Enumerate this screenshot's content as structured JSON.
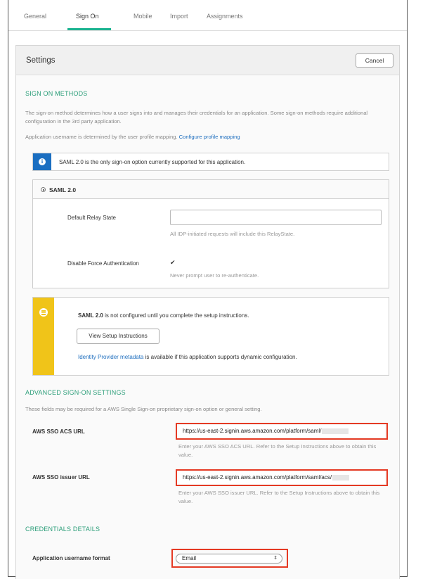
{
  "tabs": [
    "General",
    "Sign On",
    "Mobile",
    "Import",
    "Assignments"
  ],
  "settings": {
    "title": "Settings",
    "cancel_label": "Cancel"
  },
  "sign_on_methods": {
    "title": "SIGN ON METHODS",
    "desc1": "The sign-on method determines how a user signs into and manages their credentials for an application. Some sign-on methods require additional configuration in the 3rd party application.",
    "desc2": "Application username is determined by the user profile mapping.",
    "desc2_link": "Configure profile mapping",
    "info_text": "SAML 2.0 is the only sign-on option currently supported for this application.",
    "saml_label": "SAML 2.0",
    "relay_label": "Default Relay State",
    "relay_value": "",
    "relay_hint": "All IDP-initiated requests will include this RelayState.",
    "force_auth_label": "Disable Force Authentication",
    "force_auth_checked": true,
    "force_auth_hint": "Never prompt user to re-authenticate."
  },
  "warning": {
    "bold": "SAML 2.0",
    "text": " is not configured until you complete the setup instructions.",
    "button_label": "View Setup Instructions",
    "meta_link": "Identity Provider metadata",
    "meta_text": " is available if this application supports dynamic configuration."
  },
  "advanced": {
    "title": "ADVANCED SIGN-ON SETTINGS",
    "desc": "These fields may be required for a AWS Single Sign-on proprietary sign-on option or general setting.",
    "acs_label": "AWS SSO ACS URL",
    "acs_value": "https://us-east-2.signin.aws.amazon.com/platform/saml/",
    "acs_hint": "Enter your AWS SSO ACS URL. Refer to the Setup Instructions above to obtain this value.",
    "issuer_label": "AWS SSO issuer URL",
    "issuer_value": "https://us-east-2.signin.aws.amazon.com/platform/saml/acs/",
    "issuer_hint": "Enter your AWS SSO issuer URL. Refer to the Setup Instructions above to obtain this value."
  },
  "credentials": {
    "title": "CREDENTIALS DETAILS",
    "username_format_label": "Application username format",
    "username_format_value": "Email"
  },
  "colors": {
    "accent": "#1bb391",
    "section": "#2a9d78",
    "info": "#1a6ec1",
    "warning": "#f0c419",
    "highlight": "#e53a24",
    "link": "#1f6fbf"
  }
}
